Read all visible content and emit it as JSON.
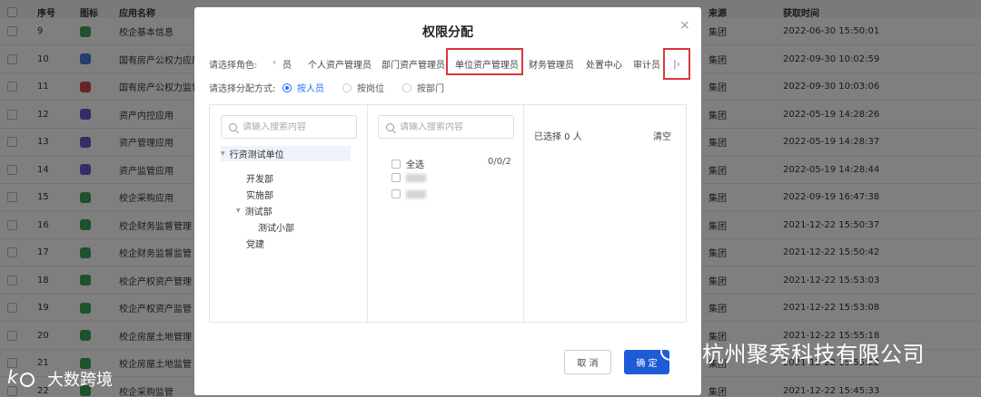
{
  "background_table": {
    "headers": {
      "no": "序号",
      "icon": "图标",
      "name": "应用名称",
      "source": "来源",
      "time": "获取时间"
    },
    "rows": [
      {
        "no": "9",
        "icon_color": "#3aa55a",
        "name": "校企基本信息",
        "source": "集团",
        "time": "2022-06-30 15:50:01"
      },
      {
        "no": "10",
        "icon_color": "#4a78d8",
        "name": "国有房产公权力应用",
        "source": "集团",
        "time": "2022-09-30 10:02:59"
      },
      {
        "no": "11",
        "icon_color": "#d44646",
        "name": "国有房产公权力监督",
        "source": "集团",
        "time": "2022-09-30 10:03:06"
      },
      {
        "no": "12",
        "icon_color": "#6a5acd",
        "name": "资产内控应用",
        "source": "集团",
        "time": "2022-05-19 14:28:26"
      },
      {
        "no": "13",
        "icon_color": "#6a5acd",
        "name": "资产管理应用",
        "source": "集团",
        "time": "2022-05-19 14:28:37"
      },
      {
        "no": "14",
        "icon_color": "#6a5acd",
        "name": "资产监管应用",
        "source": "集团",
        "time": "2022-05-19 14:28:44"
      },
      {
        "no": "15",
        "icon_color": "#3aa55a",
        "name": "校企采购应用",
        "source": "集团",
        "time": "2022-09-19 16:47:38"
      },
      {
        "no": "16",
        "icon_color": "#3aa55a",
        "name": "校企财务监督管理",
        "source": "集团",
        "time": "2021-12-22 15:50:37"
      },
      {
        "no": "17",
        "icon_color": "#3aa55a",
        "name": "校企财务监督监管",
        "source": "集团",
        "time": "2021-12-22 15:50:42"
      },
      {
        "no": "18",
        "icon_color": "#3aa55a",
        "name": "校企产权资产管理",
        "source": "集团",
        "time": "2021-12-22 15:53:03"
      },
      {
        "no": "19",
        "icon_color": "#3aa55a",
        "name": "校企产权资产监管",
        "source": "集团",
        "time": "2021-12-22 15:53:08"
      },
      {
        "no": "20",
        "icon_color": "#3aa55a",
        "name": "校企房屋土地管理",
        "source": "集团",
        "time": "2021-12-22 15:55:18"
      },
      {
        "no": "21",
        "icon_color": "#3aa55a",
        "name": "校企房屋土地监管",
        "source": "集团",
        "time": "2021-12-22 15:55:22"
      },
      {
        "no": "22",
        "icon_color": "#3aa55a",
        "name": "校企采购监管",
        "source": "集团",
        "time": "2021-12-22 15:45:33"
      }
    ]
  },
  "modal": {
    "title": "权限分配",
    "close": "×",
    "role_label": "请选择角色:",
    "roles": [
      "员",
      "个人资产管理员",
      "部门资产管理员",
      "单位资产管理员",
      "财务管理员",
      "处置中心",
      "审计员"
    ],
    "active_role_index": 3,
    "prev_symbol": "‹",
    "next_symbol": "|›",
    "mode_label": "请选择分配方式:",
    "modes": [
      "按人员",
      "按岗位",
      "按部门"
    ],
    "active_mode_index": 0,
    "left_search_placeholder": "请输入搜索内容",
    "mid_search_placeholder": "请输入搜索内容",
    "tree": [
      "行资测试单位",
      "开发部",
      "实施部",
      "测试部",
      "测试小部",
      "党建"
    ],
    "select_all": "全选",
    "count": "0/0/2",
    "selected_text": "已选择 0 人",
    "clear": "清空",
    "cancel": "取 消",
    "ok": "确 定"
  },
  "watermarks": {
    "company": "杭州聚秀科技有限公司",
    "left": "大数跨境"
  }
}
